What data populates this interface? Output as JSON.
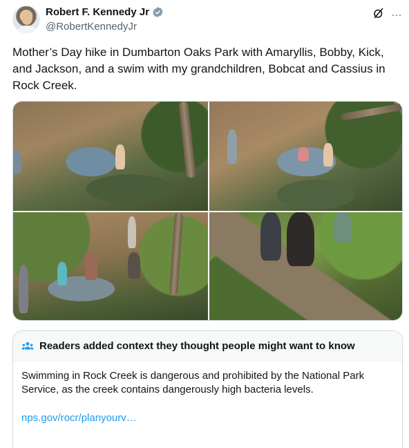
{
  "author": {
    "display_name": "Robert F. Kennedy Jr",
    "handle": "@RobertKennedyJr",
    "verified_icon": "verified-badge-icon"
  },
  "header_icons": {
    "grok": "grok-icon",
    "more": "…"
  },
  "tweet": {
    "text": "Mother’s Day hike in Dumbarton Oaks Park with Amaryllis, Bobby, Kick, and Jackson, and a swim with my grandchildren, Bobcat and Cassius in Rock Creek."
  },
  "media": {
    "count": 4
  },
  "community_note": {
    "title": "Readers added context they thought people might want to know",
    "body": "Swimming in Rock Creek is dangerous and prohibited by the National Park Service, as the creek contains dangerously high bacteria levels.",
    "link": "nps.gov/rocr/planyourv…"
  },
  "colors": {
    "link": "#1d9bf0",
    "verified": "#829aab",
    "secondary_text": "#536471"
  }
}
